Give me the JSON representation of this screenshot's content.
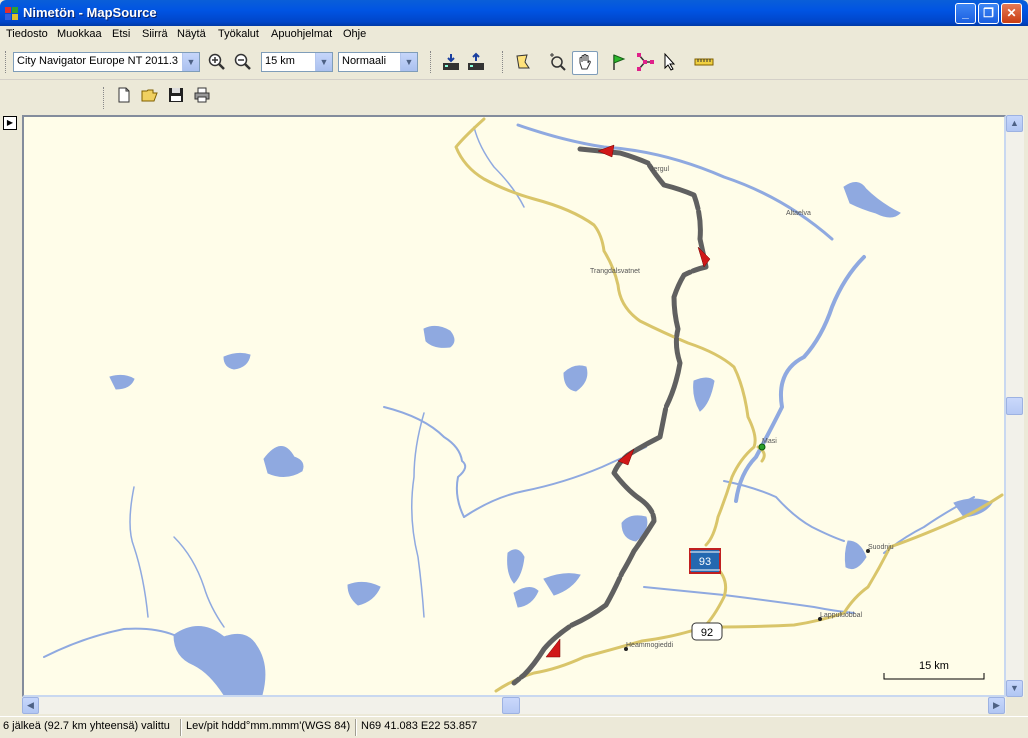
{
  "window": {
    "title": "Nimetön - MapSource",
    "controls": {
      "minimize": "_",
      "maximize": "❐",
      "close": "✕"
    }
  },
  "menu": [
    {
      "label": "Tiedosto"
    },
    {
      "label": "Muokkaa"
    },
    {
      "label": "Etsi"
    },
    {
      "label": "Siirrä"
    },
    {
      "label": "Näytä"
    },
    {
      "label": "Työkalut"
    },
    {
      "label": "Apuohjelmat"
    },
    {
      "label": "Ohje"
    }
  ],
  "toolbar": {
    "map_product": "City Navigator Europe NT 2011.3",
    "zoom_scale": "15 km",
    "detail_level": "Normaali",
    "icons": {
      "zoom_in": "zoom-in-icon",
      "zoom_out": "zoom-out-icon",
      "receive_from_device": "receive-from-device-icon",
      "send_to_device": "send-to-device-icon",
      "map_tool": "map-tool-icon",
      "zoom_tool": "zoom-tool-icon",
      "hand_tool": "hand-tool-icon",
      "waypoint_tool": "waypoint-flag-icon",
      "route_tool": "route-tool-icon",
      "selection_tool": "pointer-icon",
      "measure_tool": "ruler-icon",
      "new": "new-file-icon",
      "open": "open-folder-icon",
      "save": "save-icon",
      "print": "print-icon"
    }
  },
  "map": {
    "place_labels": {
      "jergul": "Jergul",
      "altaelva": "Altaelva",
      "trangdalsvatnet": "Trangdalsvatnet",
      "masi": "Masi",
      "suodnju": "Suodnju",
      "lappuluobbal": "Lappuluobbal",
      "heammogiedi": "Heammogieddi"
    },
    "road_shields": {
      "route_93": "93",
      "route_92": "92"
    },
    "scale_label": "15 km",
    "colors": {
      "land": "#fffde9",
      "water": "#8fa9e0",
      "road": "#d9c56a",
      "track": "#606060",
      "arrow": "#d01818"
    }
  },
  "status": {
    "selection": "6 jälkeä (92.7 km yhteensä) valittu",
    "position_format": "Lev/pit hddd°mm.mmm'(WGS 84)",
    "coordinates": "N69 41.083 E22 53.857"
  }
}
